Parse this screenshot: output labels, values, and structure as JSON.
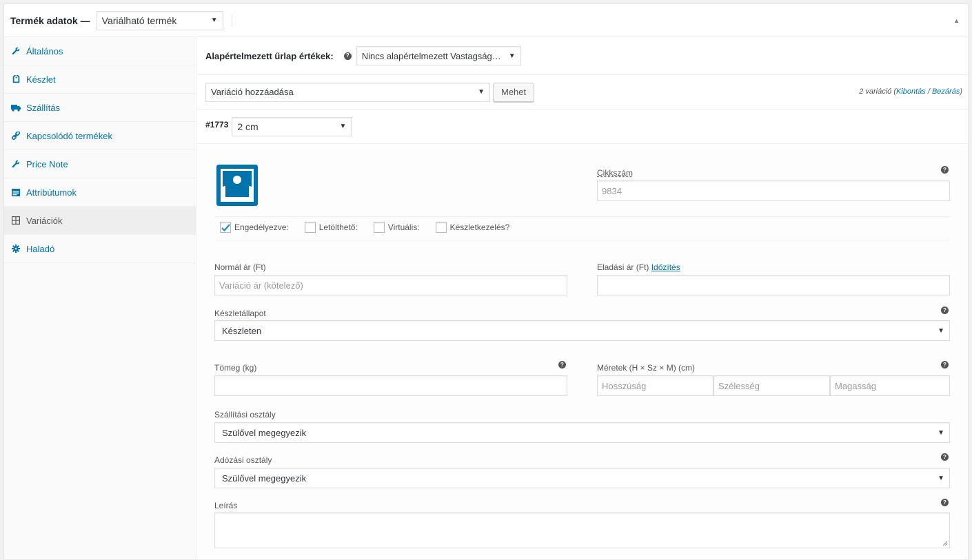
{
  "header": {
    "title": "Termék adatok —",
    "product_type": "Variálható termék"
  },
  "tabs": [
    {
      "label": "Általános",
      "icon": "wrench-icon"
    },
    {
      "label": "Készlet",
      "icon": "tag-icon"
    },
    {
      "label": "Szállítás",
      "icon": "truck-icon"
    },
    {
      "label": "Kapcsolódó termékek",
      "icon": "link-icon"
    },
    {
      "label": "Price Note",
      "icon": "wrench-icon"
    },
    {
      "label": "Attribútumok",
      "icon": "list-icon"
    },
    {
      "label": "Variációk",
      "icon": "grid-icon"
    },
    {
      "label": "Haladó",
      "icon": "gear-icon"
    }
  ],
  "defaults": {
    "label": "Alapértelmezett űrlap értékek:",
    "select_value": "Nincs alapértelmezett Vastagság…"
  },
  "add_variation": {
    "select_value": "Variáció hozzáadása",
    "button": "Mehet",
    "count_text": "2 variáció (",
    "expand": "Kibontás",
    "slash": " / ",
    "collapse": "Bezárás",
    "close_paren": ")"
  },
  "variation": {
    "id": "#1773",
    "attribute_value": "2 cm",
    "sku_label": "Cikkszám",
    "sku_placeholder": "9834",
    "checkboxes": [
      {
        "label": "Engedélyezve:",
        "checked": true
      },
      {
        "label": "Letölthető:",
        "checked": false
      },
      {
        "label": "Virtuális:",
        "checked": false
      },
      {
        "label": "Készletkezelés?",
        "checked": false
      }
    ],
    "regular_price_label": "Normál ár (Ft)",
    "regular_price_placeholder": "Variáció ár (kötelező)",
    "sale_price_label": "Eladási ár (Ft)",
    "sale_schedule_link": "Időzítés",
    "stock_status_label": "Készletállapot",
    "stock_status_value": "Készleten",
    "weight_label": "Tömeg (kg)",
    "dimensions_label": "Méretek (H × Sz × M) (cm)",
    "length_placeholder": "Hosszúság",
    "width_placeholder": "Szélesség",
    "height_placeholder": "Magasság",
    "shipping_class_label": "Szállítási osztály",
    "shipping_class_value": "Szülővel megegyezik",
    "tax_class_label": "Adózási osztály",
    "tax_class_value": "Szülővel megegyezik",
    "description_label": "Leírás"
  },
  "colors": {
    "link": "#0073aa",
    "image_icon": "#0073aa"
  }
}
